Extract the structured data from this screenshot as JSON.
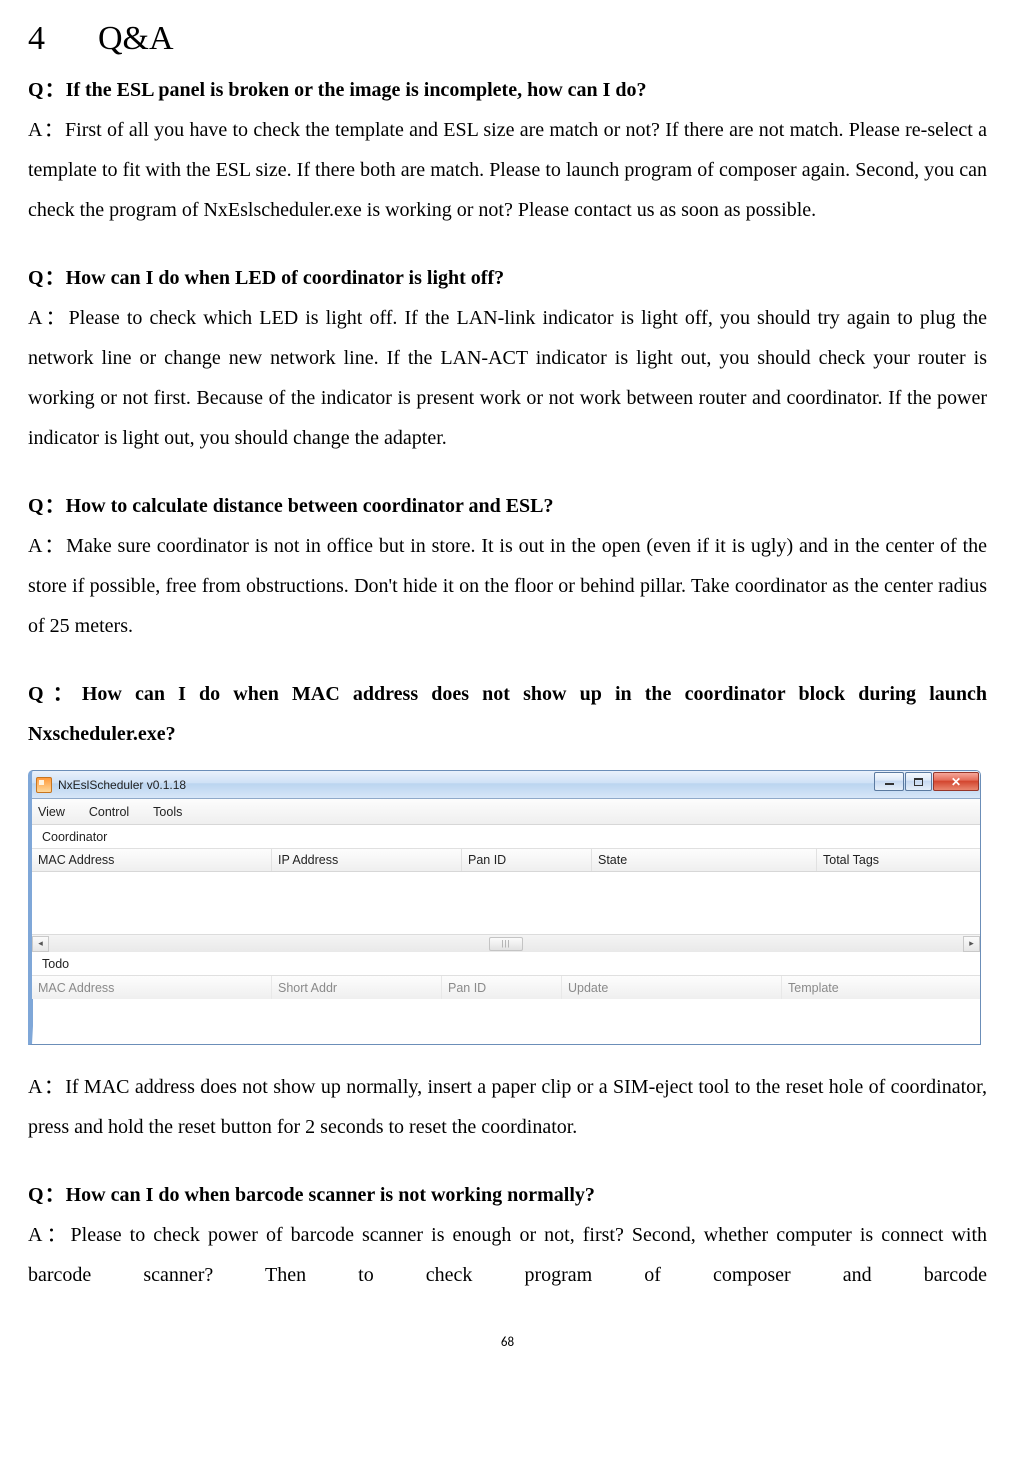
{
  "heading": {
    "num": "4",
    "title": "Q&A"
  },
  "qa": [
    {
      "q_prefix": "Q",
      "colon": "：",
      "q": "If the ESL panel is broken or the image is incomplete, how can I do?",
      "a_prefix": "A",
      "a": "First of all you have to check the template and ESL size are match or not? If there are not match. Please re-select a template to fit with the ESL size. If there both are match. Please to launch program of composer again. Second, you can check the program of NxEslscheduler.exe is working or not? Please contact us as soon as possible."
    },
    {
      "q_prefix": "Q",
      "colon": "：",
      "q": "How can I do when LED of coordinator is light off?",
      "a_prefix": "A",
      "a": "Please to check which LED is light off. If the LAN-link indicator is light off, you should try again to plug the network line or change new network line. If the LAN-ACT indicator is light out, you should check your router is working or not first. Because of the indicator is present work or not work between router and coordinator. If the power indicator is light out, you should change the adapter."
    },
    {
      "q_prefix": "Q",
      "colon": "：",
      "q": "How to calculate distance between coordinator and ESL?",
      "a_prefix": "A",
      "a": "Make sure coordinator is not in office but in store. It is out in the open (even if it is ugly) and in the center of the store if possible, free from obstructions. Don't hide it on the floor or behind pillar. Take coordinator as the center radius of 25 meters."
    },
    {
      "q_prefix": "Q",
      "colon": "：",
      "q": "How can I do when MAC address does not show up in the coordinator block during launch Nxscheduler.exe?",
      "a_prefix": "A",
      "a": "If MAC address does not show up normally, insert a paper clip or a SIM-eject tool to the reset hole of coordinator, press and hold the reset button for 2 seconds to reset the coordinator."
    },
    {
      "q_prefix": "Q",
      "colon": "：",
      "q": "How can I do when barcode scanner is not working normally?",
      "a_prefix": "A",
      "a": "Please to check power of barcode scanner is enough or not, first? Second, whether computer is connect with barcode scanner? Then to check program of composer and barcode"
    }
  ],
  "app": {
    "title": "NxEslScheduler v0.1.18",
    "menu": {
      "view": "View",
      "control": "Control",
      "tools": "Tools"
    },
    "group1": "Coordinator",
    "cols1": {
      "mac": "MAC Address",
      "ip": "IP Address",
      "pan": "Pan ID",
      "state": "State",
      "total": "Total Tags"
    },
    "group2": "Todo",
    "cols2": {
      "mac": "MAC Address",
      "short": "Short Addr",
      "pan": "Pan ID",
      "upd": "Update",
      "tpl": "Template"
    },
    "scroll_thumb": "|||"
  },
  "page_number": "68"
}
